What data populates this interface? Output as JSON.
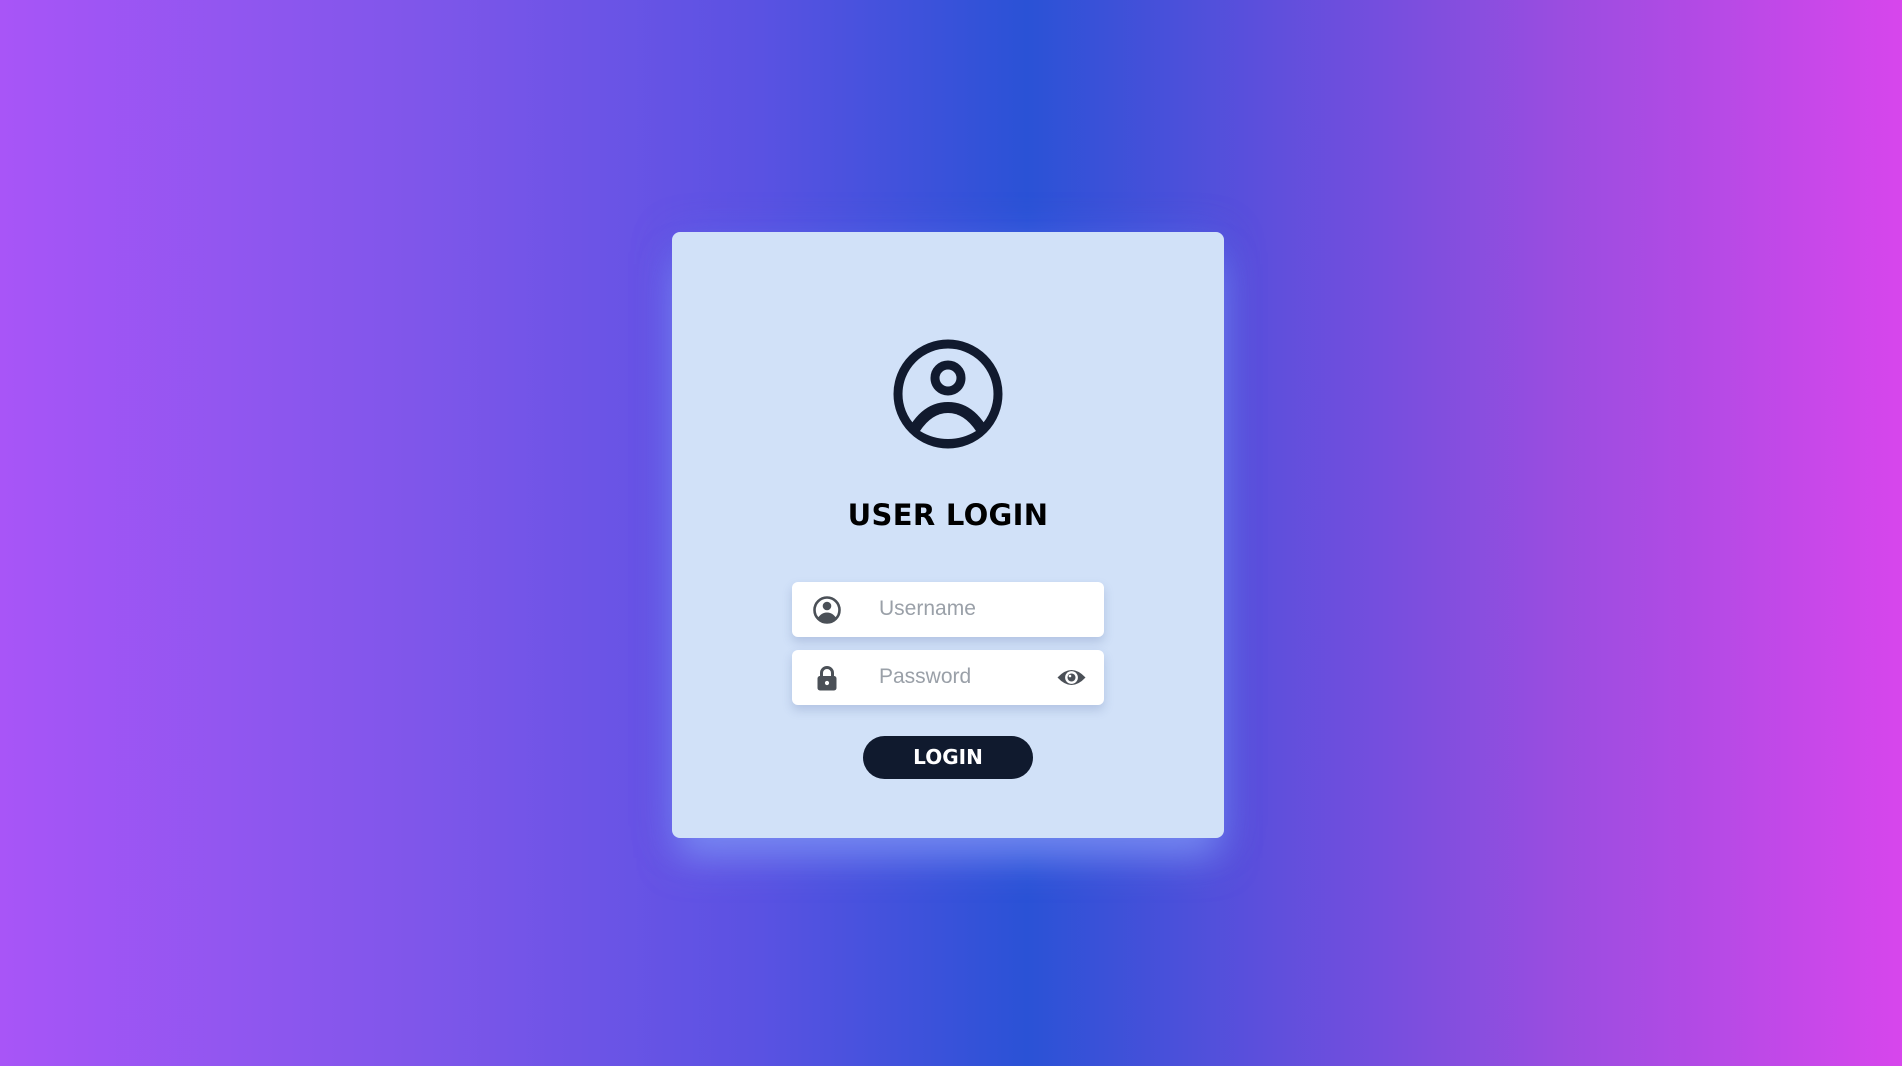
{
  "login_card": {
    "icon": "user-circle-icon",
    "title": "USER LOGIN",
    "username": {
      "icon": "user-circle-icon",
      "placeholder": "Username",
      "value": ""
    },
    "password": {
      "icon": "lock-icon",
      "toggle_icon": "eye-icon",
      "placeholder": "Password",
      "value": ""
    },
    "submit_label": "LOGIN"
  },
  "colors": {
    "background_gradient": [
      "#a855f7",
      "#2a52d6",
      "#d746ec"
    ],
    "card_background": "#d1e1f8",
    "button_background": "#101a2e",
    "icon_color": "#111a2e"
  }
}
